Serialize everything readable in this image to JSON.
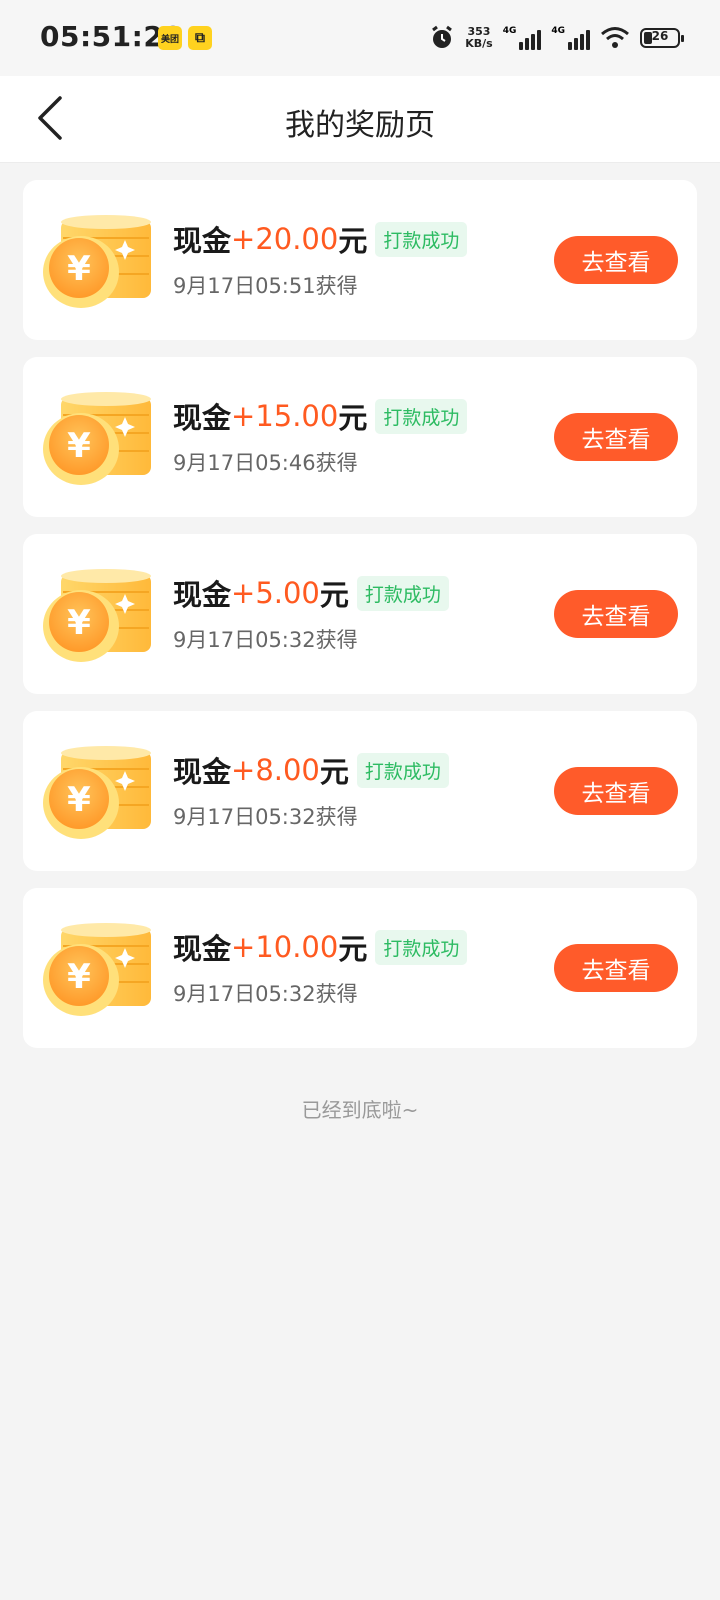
{
  "status_bar": {
    "time": "05:51:28",
    "app_badges": [
      "美团",
      "⧉"
    ],
    "speed_value": "353",
    "speed_unit": "KB/s",
    "network_tags": [
      "4G",
      "4G"
    ],
    "battery": "26"
  },
  "header": {
    "title": "我的奖励页"
  },
  "rewards": [
    {
      "label": "现金",
      "amount": "+20.00",
      "unit": "元",
      "status": "打款成功",
      "time": "9月17日05:51获得",
      "button": "去查看"
    },
    {
      "label": "现金",
      "amount": "+15.00",
      "unit": "元",
      "status": "打款成功",
      "time": "9月17日05:46获得",
      "button": "去查看"
    },
    {
      "label": "现金",
      "amount": "+5.00",
      "unit": "元",
      "status": "打款成功",
      "time": "9月17日05:32获得",
      "button": "去查看"
    },
    {
      "label": "现金",
      "amount": "+8.00",
      "unit": "元",
      "status": "打款成功",
      "time": "9月17日05:32获得",
      "button": "去查看"
    },
    {
      "label": "现金",
      "amount": "+10.00",
      "unit": "元",
      "status": "打款成功",
      "time": "9月17日05:32获得",
      "button": "去查看"
    }
  ],
  "footer": {
    "end_text": "已经到底啦~"
  },
  "colors": {
    "accent": "#ff5b2a",
    "amount": "#ff5a20",
    "success": "#2dbb62"
  }
}
